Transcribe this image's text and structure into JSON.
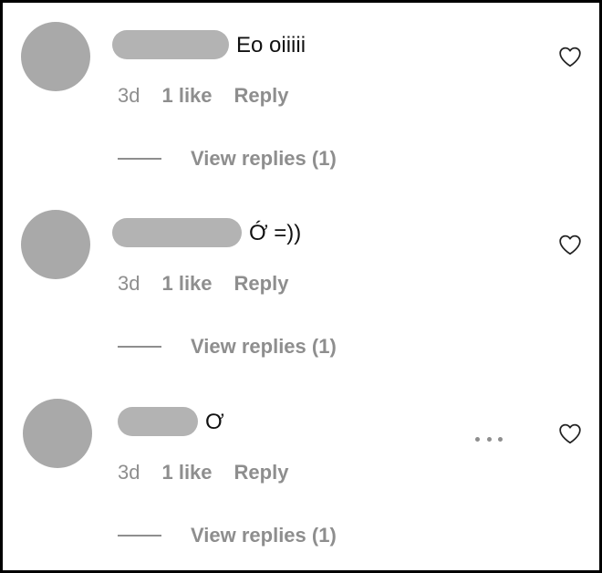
{
  "comments": [
    {
      "text": "Eo oiiiii",
      "time": "3d",
      "likes": "1 like",
      "reply": "Reply",
      "view_replies": "View replies (1)"
    },
    {
      "text": "Ớ =))",
      "time": "3d",
      "likes": "1 like",
      "reply": "Reply",
      "view_replies": "View replies (1)"
    },
    {
      "text": "Ơ",
      "time": "3d",
      "likes": "1 like",
      "reply": "Reply",
      "view_replies": "View replies (1)"
    }
  ],
  "icons": {
    "like": "heart-icon",
    "options": "more-options-icon"
  },
  "colors": {
    "avatar": "#a9a9a9",
    "name_redaction": "#b3b3b3",
    "secondary_text": "#8e8e8e",
    "primary_text": "#111111"
  }
}
